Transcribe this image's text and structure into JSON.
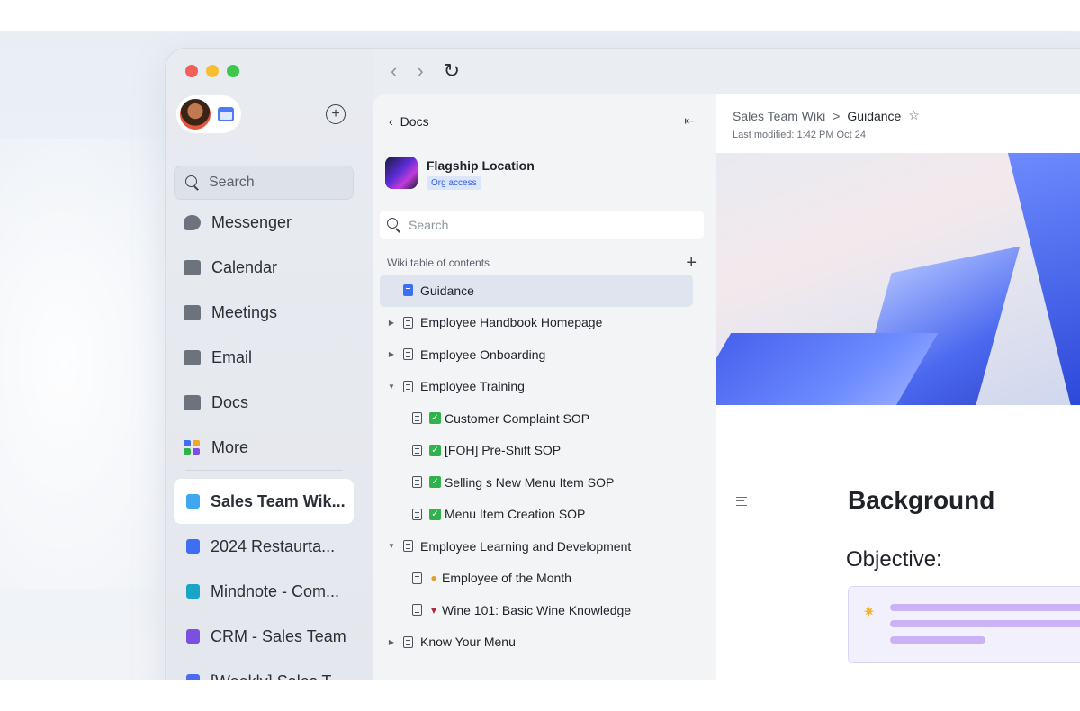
{
  "sidebar": {
    "search_label": "Search",
    "nav": [
      {
        "label": "Messenger",
        "icon": "messenger-icon"
      },
      {
        "label": "Calendar",
        "icon": "calendar-icon"
      },
      {
        "label": "Meetings",
        "icon": "video-camera-icon"
      },
      {
        "label": "Email",
        "icon": "envelope-icon"
      },
      {
        "label": "Docs",
        "icon": "docs-icon"
      },
      {
        "label": "More",
        "icon": "apps-grid-icon"
      }
    ],
    "pinned": [
      {
        "label": "Sales Team Wik...",
        "color": "#3fa7f0",
        "active": true
      },
      {
        "label": "2024 Restaurta...",
        "color": "#3d6ef5"
      },
      {
        "label": "Mindnote - Com...",
        "color": "#17a6c7"
      },
      {
        "label": "CRM - Sales Team",
        "color": "#7b4fe0"
      },
      {
        "label": "[Weekly] Sales T...",
        "color": "#4b6bf0"
      }
    ]
  },
  "toolbar": {
    "back": "‹",
    "forward": "›",
    "refresh": "↻"
  },
  "docs": {
    "back_label": "Docs",
    "workspace_name": "Flagship Location",
    "workspace_badge": "Org access",
    "search_placeholder": "Search",
    "toc_title": "Wiki table of contents",
    "toc": [
      {
        "label": "Guidance",
        "level": 0,
        "caret": "",
        "active": true,
        "icon": "blue",
        "prefix": ""
      },
      {
        "label": "Employee Handbook Homepage",
        "level": 0,
        "caret": "▶",
        "prefix": ""
      },
      {
        "label": "Employee Onboarding",
        "level": 0,
        "caret": "▶",
        "prefix": ""
      },
      {
        "label": "Employee Training",
        "level": 0,
        "caret": "▼",
        "prefix": ""
      },
      {
        "label": "Customer Complaint SOP",
        "level": 1,
        "caret": "",
        "prefix": "check"
      },
      {
        "label": "[FOH] Pre-Shift SOP",
        "level": 1,
        "caret": "",
        "prefix": "check"
      },
      {
        "label": "Selling s New Menu Item SOP",
        "level": 1,
        "caret": "",
        "prefix": "check"
      },
      {
        "label": "Menu Item Creation SOP",
        "level": 1,
        "caret": "",
        "prefix": "check"
      },
      {
        "label": "Employee Learning and Development",
        "level": 0,
        "caret": "▼",
        "prefix": ""
      },
      {
        "label": "Employee of the Month",
        "level": 1,
        "caret": "",
        "prefix": "medal"
      },
      {
        "label": "Wine 101: Basic Wine Knowledge",
        "level": 1,
        "caret": "",
        "prefix": "wine"
      },
      {
        "label": "Know Your Menu",
        "level": 0,
        "caret": "▶",
        "prefix": ""
      }
    ]
  },
  "content": {
    "breadcrumb_parent": "Sales Team Wiki",
    "breadcrumb_sep": ">",
    "breadcrumb_current": "Guidance",
    "last_modified": "Last modified: 1:42 PM Oct 24",
    "heading": "Background",
    "subheading": "Objective:"
  }
}
